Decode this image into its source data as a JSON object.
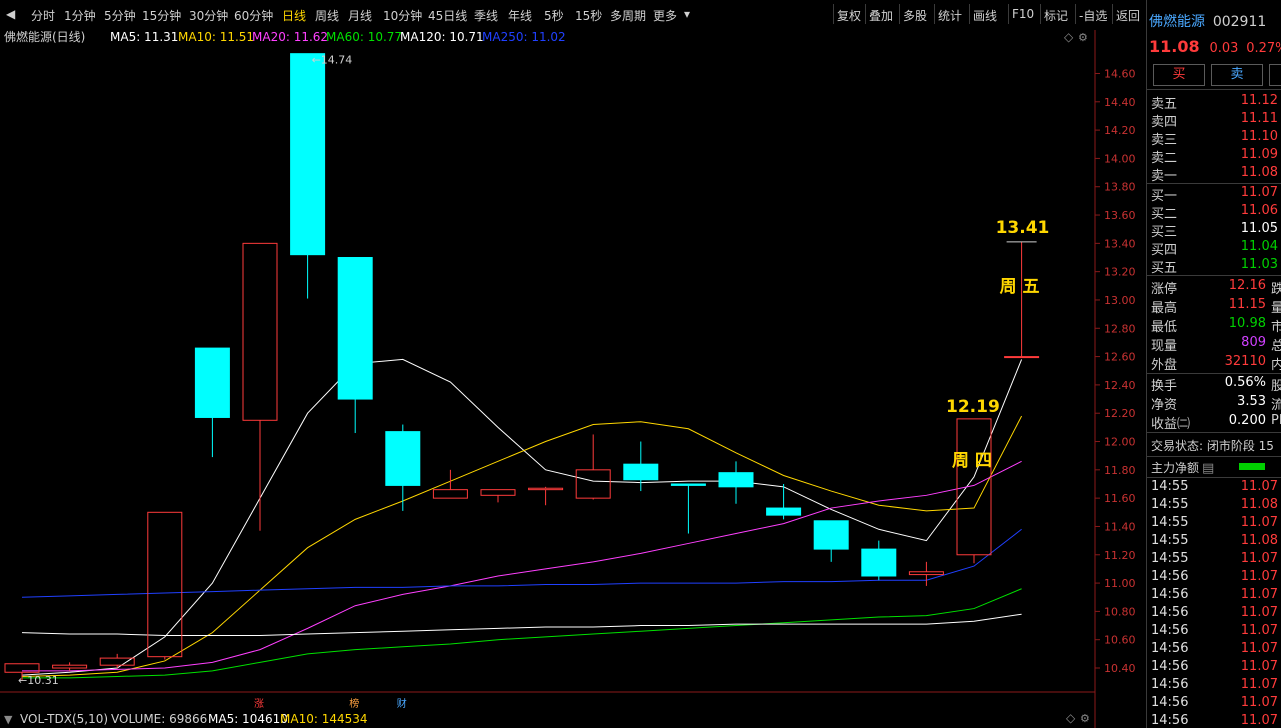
{
  "toolbar": {
    "periods": [
      "分时",
      "1分钟",
      "5分钟",
      "15分钟",
      "30分钟",
      "60分钟",
      "日线",
      "周线",
      "月线",
      "10分钟",
      "45日线",
      "季线",
      "年线",
      "5秒",
      "15秒",
      "多周期",
      "更多"
    ],
    "active_index": 6,
    "tools": [
      "复权",
      "叠加",
      "多股",
      "统计",
      "画线",
      "F10",
      "标记",
      "-自选",
      "返回"
    ]
  },
  "legend": {
    "name": "佛燃能源(日线)",
    "ma": [
      {
        "label": "MA5: 11.31",
        "color": "#ffffff"
      },
      {
        "label": "MA10: 11.51",
        "color": "#ffd700"
      },
      {
        "label": "MA20: 11.62",
        "color": "#ff40ff"
      },
      {
        "label": "MA60: 10.77",
        "color": "#00e000"
      },
      {
        "label": "MA120: 10.71",
        "color": "#ffffff"
      },
      {
        "label": "MA250: 11.02",
        "color": "#2040ff"
      }
    ]
  },
  "volume_legend": {
    "label": "VOL-TDX(5,10)",
    "volume": "VOLUME: 69866",
    "ma5": "MA5: 104610",
    "ma10": "MA10: 144534"
  },
  "annotations": {
    "high_label": "14.74",
    "low_label": "10.31",
    "label_1341": "13.41",
    "label_friday": "周 五",
    "label_1219": "12.19",
    "label_thursday": "周 四",
    "marker_zhang": "涨",
    "marker_bang": "榜",
    "marker_cai": "财"
  },
  "chart_data": {
    "type": "candlestick",
    "y_ticks": [
      "14.60",
      "14.40",
      "14.20",
      "14.00",
      "13.80",
      "13.60",
      "13.40",
      "13.20",
      "13.00",
      "12.80",
      "12.60",
      "12.40",
      "12.20",
      "12.00",
      "11.80",
      "11.60",
      "11.40",
      "11.20",
      "11.00",
      "10.80",
      "10.60",
      "10.40"
    ],
    "ylim": [
      10.28,
      14.78
    ],
    "candles": [
      {
        "o": 10.37,
        "c": 10.43,
        "h": 10.43,
        "l": 10.31
      },
      {
        "o": 10.4,
        "c": 10.42,
        "h": 10.44,
        "l": 10.38
      },
      {
        "o": 10.42,
        "c": 10.47,
        "h": 10.5,
        "l": 10.4
      },
      {
        "o": 10.48,
        "c": 11.5,
        "h": 11.5,
        "l": 10.46
      },
      {
        "o": 12.66,
        "c": 12.17,
        "h": 12.66,
        "l": 11.89
      },
      {
        "o": 12.15,
        "c": 13.4,
        "h": 13.4,
        "l": 11.37
      },
      {
        "o": 14.74,
        "c": 13.32,
        "h": 14.74,
        "l": 13.01
      },
      {
        "o": 13.3,
        "c": 12.3,
        "h": 13.3,
        "l": 12.06
      },
      {
        "o": 12.07,
        "c": 11.69,
        "h": 12.12,
        "l": 11.51
      },
      {
        "o": 11.6,
        "c": 11.66,
        "h": 11.8,
        "l": 11.6
      },
      {
        "o": 11.62,
        "c": 11.66,
        "h": 11.66,
        "l": 11.57
      },
      {
        "o": 11.66,
        "c": 11.67,
        "h": 11.68,
        "l": 11.55
      },
      {
        "o": 11.6,
        "c": 11.8,
        "h": 12.05,
        "l": 11.59
      },
      {
        "o": 11.84,
        "c": 11.73,
        "h": 12.0,
        "l": 11.65
      },
      {
        "o": 11.7,
        "c": 11.69,
        "h": 11.7,
        "l": 11.35
      },
      {
        "o": 11.78,
        "c": 11.68,
        "h": 11.86,
        "l": 11.56
      },
      {
        "o": 11.53,
        "c": 11.48,
        "h": 11.7,
        "l": 11.45
      },
      {
        "o": 11.44,
        "c": 11.24,
        "h": 11.44,
        "l": 11.15
      },
      {
        "o": 11.24,
        "c": 11.05,
        "h": 11.3,
        "l": 11.02
      },
      {
        "o": 11.06,
        "c": 11.08,
        "h": 11.15,
        "l": 10.98
      },
      {
        "o": 11.2,
        "c": 12.16,
        "h": 12.16,
        "l": 11.14
      },
      {
        "o": 12.6,
        "c": 12.6,
        "h": 13.41,
        "l": 12.6
      }
    ],
    "series": [
      {
        "name": "MA5",
        "color": "#ffffff",
        "values": [
          10.35,
          10.37,
          10.4,
          10.62,
          11.0,
          11.6,
          12.2,
          12.55,
          12.58,
          12.42,
          12.1,
          11.8,
          11.72,
          11.71,
          11.72,
          11.72,
          11.68,
          11.52,
          11.38,
          11.3,
          11.75,
          12.58
        ]
      },
      {
        "name": "MA10",
        "color": "#ffd700",
        "values": [
          10.34,
          10.35,
          10.37,
          10.45,
          10.65,
          10.95,
          11.25,
          11.45,
          11.58,
          11.72,
          11.86,
          12.0,
          12.12,
          12.14,
          12.09,
          11.92,
          11.76,
          11.65,
          11.55,
          11.51,
          11.53,
          12.18
        ]
      },
      {
        "name": "MA20",
        "color": "#ff40ff",
        "values": [
          10.38,
          10.38,
          10.39,
          10.4,
          10.44,
          10.53,
          10.68,
          10.84,
          10.92,
          10.98,
          11.05,
          11.1,
          11.15,
          11.21,
          11.28,
          11.35,
          11.42,
          11.53,
          11.58,
          11.62,
          11.69,
          11.86
        ]
      },
      {
        "name": "MA60",
        "color": "#00e000",
        "values": [
          10.33,
          10.33,
          10.34,
          10.35,
          10.38,
          10.44,
          10.5,
          10.53,
          10.55,
          10.57,
          10.6,
          10.62,
          10.64,
          10.66,
          10.68,
          10.7,
          10.72,
          10.74,
          10.76,
          10.77,
          10.82,
          10.96
        ]
      },
      {
        "name": "MA120",
        "color": "#ffffff",
        "values": [
          10.65,
          10.64,
          10.64,
          10.63,
          10.63,
          10.63,
          10.64,
          10.65,
          10.66,
          10.67,
          10.68,
          10.69,
          10.69,
          10.7,
          10.7,
          10.71,
          10.71,
          10.71,
          10.71,
          10.71,
          10.73,
          10.78
        ]
      },
      {
        "name": "MA250",
        "color": "#2040ff",
        "values": [
          10.9,
          10.91,
          10.92,
          10.93,
          10.94,
          10.95,
          10.96,
          10.97,
          10.97,
          10.98,
          10.98,
          10.99,
          10.99,
          11.0,
          11.0,
          11.0,
          11.01,
          11.01,
          11.02,
          11.02,
          11.12,
          11.38
        ]
      }
    ]
  },
  "panel": {
    "stock_name": "佛燃能源",
    "stock_code": "002911",
    "price": "11.08",
    "change": "0.03",
    "change_pct": "0.27%",
    "ri": "R®",
    "buy_button": "买",
    "sell_button": "卖",
    "asks": [
      {
        "label": "卖五",
        "price": "11.12"
      },
      {
        "label": "卖四",
        "price": "11.11"
      },
      {
        "label": "卖三",
        "price": "11.10"
      },
      {
        "label": "卖二",
        "price": "11.09"
      },
      {
        "label": "卖一",
        "price": "11.08"
      }
    ],
    "bids": [
      {
        "label": "买一",
        "price": "11.07"
      },
      {
        "label": "买二",
        "price": "11.06"
      },
      {
        "label": "买三",
        "price": "11.05"
      },
      {
        "label": "买四",
        "price": "11.04"
      },
      {
        "label": "买五",
        "price": "11.03"
      }
    ],
    "stats": [
      {
        "label": "涨停",
        "value": "12.16",
        "cls": "red",
        "ext": "跌"
      },
      {
        "label": "最高",
        "value": "11.15",
        "cls": "red",
        "ext": "量"
      },
      {
        "label": "最低",
        "value": "10.98",
        "cls": "green",
        "ext": "市"
      },
      {
        "label": "现量",
        "value": "809",
        "cls": "purple",
        "ext": "总"
      },
      {
        "label": "外盘",
        "value": "32110",
        "cls": "red",
        "ext": "内"
      }
    ],
    "stats2": [
      {
        "label": "换手",
        "value": "0.56%",
        "cls": "white",
        "ext": "股"
      },
      {
        "label": "净资",
        "value": "3.53",
        "cls": "white",
        "ext": "流"
      },
      {
        "label": "收益㈡",
        "value": "0.200",
        "cls": "white",
        "ext": "PE"
      }
    ],
    "trade_status": "交易状态: 闭市阶段 15",
    "net_inflow_label": "主力净额",
    "ticks": [
      {
        "time": "14:55",
        "price": "11.07"
      },
      {
        "time": "14:55",
        "price": "11.08"
      },
      {
        "time": "14:55",
        "price": "11.07"
      },
      {
        "time": "14:55",
        "price": "11.08"
      },
      {
        "time": "14:55",
        "price": "11.07"
      },
      {
        "time": "14:56",
        "price": "11.07"
      },
      {
        "time": "14:56",
        "price": "11.07"
      },
      {
        "time": "14:56",
        "price": "11.07"
      },
      {
        "time": "14:56",
        "price": "11.07"
      },
      {
        "time": "14:56",
        "price": "11.07"
      },
      {
        "time": "14:56",
        "price": "11.07"
      },
      {
        "time": "14:56",
        "price": "11.07"
      },
      {
        "time": "14:56",
        "price": "11.07"
      },
      {
        "time": "14:56",
        "price": "11.07"
      }
    ]
  }
}
